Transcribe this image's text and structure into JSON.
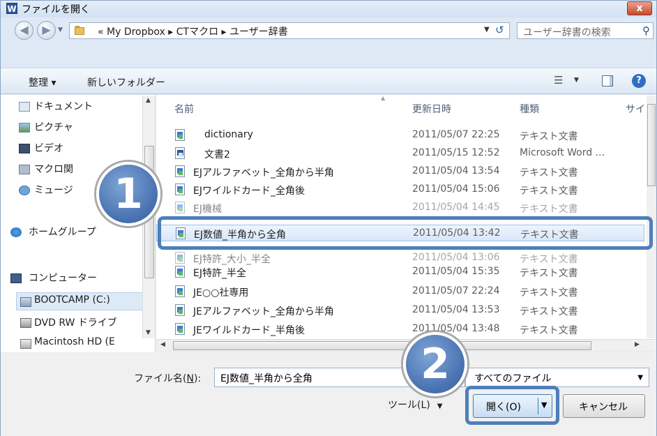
{
  "window": {
    "app_icon": "W",
    "title": "ファイルを開く",
    "close_label": "x"
  },
  "address": {
    "path": "« My Dropbox ▸ CTマクロ ▸ ユーザー辞書",
    "search_placeholder": "ユーザー辞書の検索"
  },
  "toolbar": {
    "organize": "整理 ▾",
    "new_folder": "新しいフォルダー"
  },
  "nav": {
    "items": [
      {
        "label": "ドキュメント"
      },
      {
        "label": "ピクチャ"
      },
      {
        "label": "ビデオ"
      },
      {
        "label": "マクロ関"
      },
      {
        "label": "ミュージ"
      },
      {
        "label": "ホームグループ"
      },
      {
        "label": "コンピューター"
      },
      {
        "label": "BOOTCAMP (C:)"
      },
      {
        "label": "DVD RW ドライブ"
      },
      {
        "label": "Macintosh HD (E"
      }
    ]
  },
  "columns": {
    "name": "名前",
    "date": "更新日時",
    "type": "種類",
    "size": "サイ"
  },
  "files": [
    {
      "name": "dictionary",
      "date": "2011/05/07 22:25",
      "type": "テキスト文書"
    },
    {
      "name": "文書2",
      "date": "2011/05/15 12:52",
      "type": "Microsoft Word ..."
    },
    {
      "name": "EJアルファベット_全角から半角",
      "date": "2011/05/04 13:54",
      "type": "テキスト文書"
    },
    {
      "name": "EJワイルドカード_全角後",
      "date": "2011/05/04 15:06",
      "type": "テキスト文書"
    },
    {
      "name": "EJ機械",
      "date": "2011/05/04 14:45",
      "type": "テキスト文書"
    },
    {
      "name": "EJ数値_半角から全角",
      "date": "2011/05/04 13:42",
      "type": "テキスト文書"
    },
    {
      "name": "EJ特許_大小_半全",
      "date": "2011/05/04 13:06",
      "type": "テキスト文書"
    },
    {
      "name": "EJ特許_半全",
      "date": "2011/05/04 15:35",
      "type": "テキスト文書"
    },
    {
      "name": "JE○○社専用",
      "date": "2011/05/07 22:24",
      "type": "テキスト文書"
    },
    {
      "name": "JEアルファベット_全角から半角",
      "date": "2011/05/04 13:53",
      "type": "テキスト文書"
    },
    {
      "name": "JEワイルドカード_半角後",
      "date": "2011/05/04 13:48",
      "type": "テキスト文書"
    }
  ],
  "bottom": {
    "filename_label_pre": "ファイル名(",
    "filename_label_key": "N",
    "filename_label_post": "):",
    "filename_value": "EJ数値_半角から全角",
    "filetype_value": "すべてのファイル",
    "tools_label": "ツール(L)",
    "open_label": "開く(O)",
    "cancel_label": "キャンセル"
  },
  "badges": {
    "step1": "1",
    "step2": "2"
  },
  "colors": {
    "accent": "#4d7fba",
    "selection": "#d7e7f9"
  }
}
